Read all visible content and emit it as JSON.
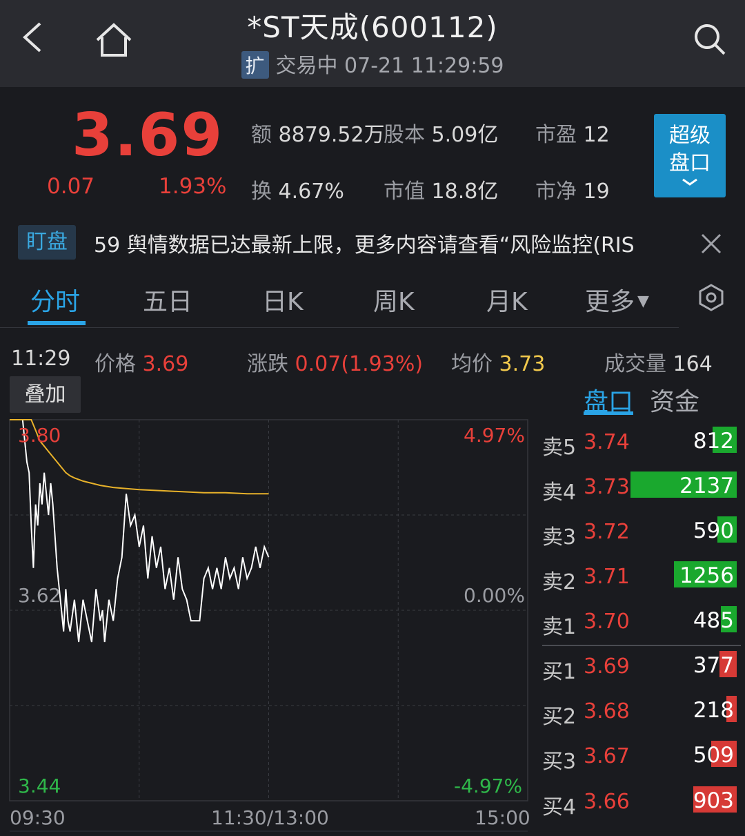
{
  "header": {
    "title": "*ST天成(600112)",
    "badge": "扩",
    "status": "交易中 07-21 11:29:59"
  },
  "quote": {
    "price": "3.69",
    "change": "0.07",
    "change_pct": "1.93%",
    "amount_label": "额",
    "amount": "8879.52万",
    "share_cap_label": "股本",
    "share_cap": "5.09亿",
    "pe_label": "市盈",
    "pe": "12",
    "turnover_label": "换",
    "turnover": "4.67%",
    "mkt_cap_label": "市值",
    "mkt_cap": "18.8亿",
    "pb_label": "市净",
    "pb": "19",
    "super_button_line1": "超级",
    "super_button_line2": "盘口"
  },
  "notice": {
    "badge": "盯盘",
    "text": "59 舆情数据已达最新上限，更多内容请查看“风险监控(RIS"
  },
  "tabs": [
    "分时",
    "五日",
    "日K",
    "周K",
    "月K",
    "更多"
  ],
  "info": {
    "time": "11:29",
    "price_label": "价格",
    "price": "3.69",
    "change_label": "涨跌",
    "change": "0.07(1.93%)",
    "avg_label": "均价",
    "avg": "3.73",
    "volume_label": "成交量",
    "volume": "164"
  },
  "overlay_button": "叠加",
  "side_tabs": [
    "盘口",
    "资金"
  ],
  "chart_data": {
    "type": "line",
    "y_left_ticks": [
      "3.80",
      "3.62",
      "3.44"
    ],
    "y_right_ticks": [
      "4.97%",
      "0.00%",
      "-4.97%"
    ],
    "x_ticks": [
      "09:30",
      "11:30/13:00",
      "15:00"
    ],
    "ylim": [
      3.44,
      3.8
    ],
    "grid": true,
    "series": [
      {
        "color": "#ffffff",
        "x": [
          0,
          3,
          5,
          6,
          7,
          8,
          9,
          10,
          11,
          12,
          13,
          14,
          15,
          16,
          17,
          18,
          19,
          20,
          22,
          24,
          25,
          26,
          27,
          28,
          30,
          32,
          34,
          36,
          38,
          40,
          42,
          43,
          44,
          46,
          48,
          50,
          52,
          54,
          56,
          58,
          60,
          62,
          64,
          66,
          68,
          70,
          72,
          74,
          76,
          78,
          80,
          82,
          84,
          86,
          88,
          90,
          92,
          94,
          96,
          98,
          100,
          102,
          104,
          106,
          108,
          110,
          112,
          114,
          116,
          118,
          120
        ],
        "y": [
          3.8,
          3.8,
          3.8,
          3.8,
          3.78,
          3.76,
          3.75,
          3.7,
          3.66,
          3.72,
          3.7,
          3.74,
          3.72,
          3.75,
          3.73,
          3.71,
          3.74,
          3.72,
          3.66,
          3.62,
          3.6,
          3.64,
          3.61,
          3.6,
          3.63,
          3.59,
          3.63,
          3.61,
          3.59,
          3.64,
          3.61,
          3.62,
          3.59,
          3.63,
          3.61,
          3.65,
          3.67,
          3.73,
          3.7,
          3.71,
          3.68,
          3.7,
          3.65,
          3.69,
          3.66,
          3.68,
          3.64,
          3.66,
          3.63,
          3.67,
          3.64,
          3.63,
          3.61,
          3.61,
          3.61,
          3.65,
          3.66,
          3.64,
          3.66,
          3.64,
          3.67,
          3.65,
          3.66,
          3.64,
          3.67,
          3.65,
          3.66,
          3.68,
          3.66,
          3.68,
          3.67
        ]
      },
      {
        "color": "#e8b22a",
        "x": [
          0,
          10,
          12,
          14,
          16,
          18,
          20,
          22,
          24,
          26,
          28,
          30,
          34,
          38,
          42,
          48,
          54,
          60,
          70,
          80,
          90,
          100,
          110,
          120
        ],
        "y": [
          3.8,
          3.8,
          3.79,
          3.78,
          3.775,
          3.77,
          3.765,
          3.76,
          3.755,
          3.75,
          3.747,
          3.745,
          3.742,
          3.74,
          3.738,
          3.736,
          3.735,
          3.734,
          3.733,
          3.732,
          3.731,
          3.731,
          3.73,
          3.73
        ]
      }
    ],
    "x_range": [
      0,
      240
    ]
  },
  "orderbook": {
    "asks": [
      {
        "label": "卖5",
        "price": "3.74",
        "volume": "812",
        "fill": 0.23
      },
      {
        "label": "卖4",
        "price": "3.73",
        "volume": "2137",
        "fill": 1.0
      },
      {
        "label": "卖3",
        "price": "3.72",
        "volume": "590",
        "fill": 0.18
      },
      {
        "label": "卖2",
        "price": "3.71",
        "volume": "1256",
        "fill": 0.59
      },
      {
        "label": "卖1",
        "price": "3.70",
        "volume": "485",
        "fill": 0.15
      }
    ],
    "bids": [
      {
        "label": "买1",
        "price": "3.69",
        "volume": "377",
        "fill": 0.16
      },
      {
        "label": "买2",
        "price": "3.68",
        "volume": "218",
        "fill": 0.1
      },
      {
        "label": "买3",
        "price": "3.67",
        "volume": "509",
        "fill": 0.24
      },
      {
        "label": "买4",
        "price": "3.66",
        "volume": "903",
        "fill": 0.41
      }
    ],
    "ask_color": "#1aa82e",
    "bid_color": "#d63a36"
  }
}
